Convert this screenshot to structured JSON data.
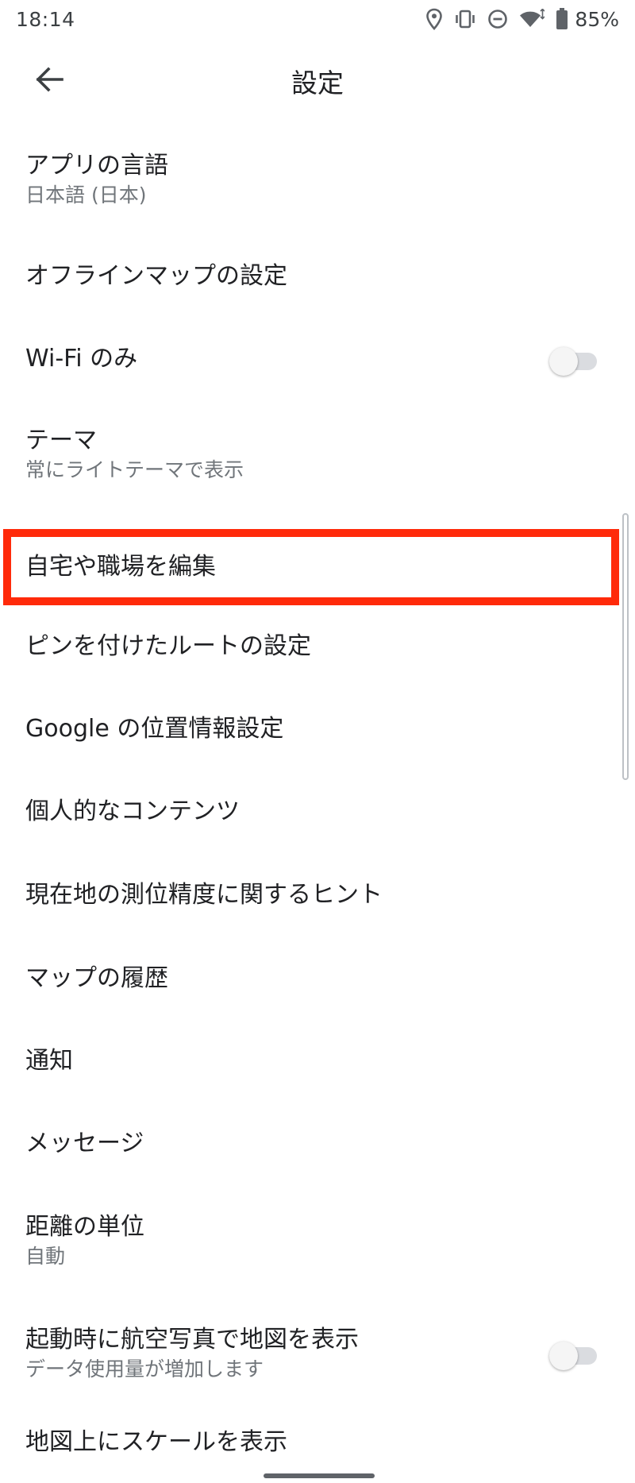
{
  "status_bar": {
    "time": "18:14",
    "battery_percent": "85%",
    "icons": [
      "location-icon",
      "vibrate-icon",
      "do-not-disturb-icon",
      "wifi-icon",
      "battery-icon"
    ]
  },
  "app_bar": {
    "title": "設定",
    "back_icon": "arrow-back-icon"
  },
  "settings": {
    "items": [
      {
        "title": "アプリの言語",
        "subtitle": "日本語 (日本)"
      },
      {
        "title": "オフラインマップの設定"
      },
      {
        "title": "Wi-Fi のみ",
        "toggle": false
      },
      {
        "title": "テーマ",
        "subtitle": "常にライトテーマで表示"
      },
      {
        "title": "自宅や職場を編集",
        "highlighted": true
      },
      {
        "title": "ピンを付けたルートの設定"
      },
      {
        "title": "Google の位置情報設定"
      },
      {
        "title": "個人的なコンテンツ"
      },
      {
        "title": "現在地の測位精度に関するヒント"
      },
      {
        "title": "マップの履歴"
      },
      {
        "title": "通知"
      },
      {
        "title": "メッセージ"
      },
      {
        "title": "距離の単位",
        "subtitle": "自動"
      },
      {
        "title": "起動時に航空写真で地図を表示",
        "subtitle": "データ使用量が増加します",
        "toggle": false
      },
      {
        "title": "地図上にスケールを表示"
      }
    ]
  },
  "colors": {
    "highlight": "#ff2a0a",
    "primary_text": "#202124",
    "secondary_text": "#70757a",
    "toggle_off_track": "#dadce0"
  }
}
